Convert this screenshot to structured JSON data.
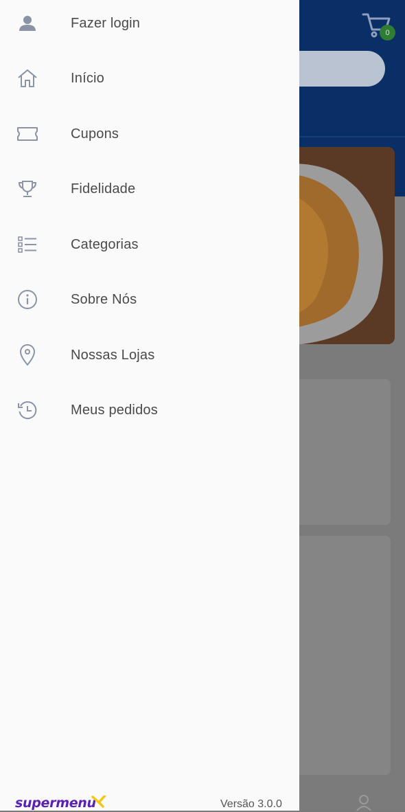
{
  "background": {
    "cart_badge": "0"
  },
  "menu": [
    {
      "label": "Fazer login",
      "icon": "user-icon"
    },
    {
      "label": "Início",
      "icon": "home-icon"
    },
    {
      "label": "Cupons",
      "icon": "ticket-icon"
    },
    {
      "label": "Fidelidade",
      "icon": "trophy-icon"
    },
    {
      "label": "Categorias",
      "icon": "list-icon"
    },
    {
      "label": "Sobre Nós",
      "icon": "info-icon"
    },
    {
      "label": "Nossas Lojas",
      "icon": "location-pin-icon"
    },
    {
      "label": "Meus pedidos",
      "icon": "history-icon"
    }
  ],
  "footer": {
    "brand": "supermenu",
    "version": "Versão 3.0.0"
  },
  "colors": {
    "header": "#0a2f66",
    "drawer": "#fafafa",
    "brand": "#5a21b5",
    "brand_accent": "#f5c518",
    "icon": "#8a94a6",
    "badge": "#2e7d32"
  }
}
